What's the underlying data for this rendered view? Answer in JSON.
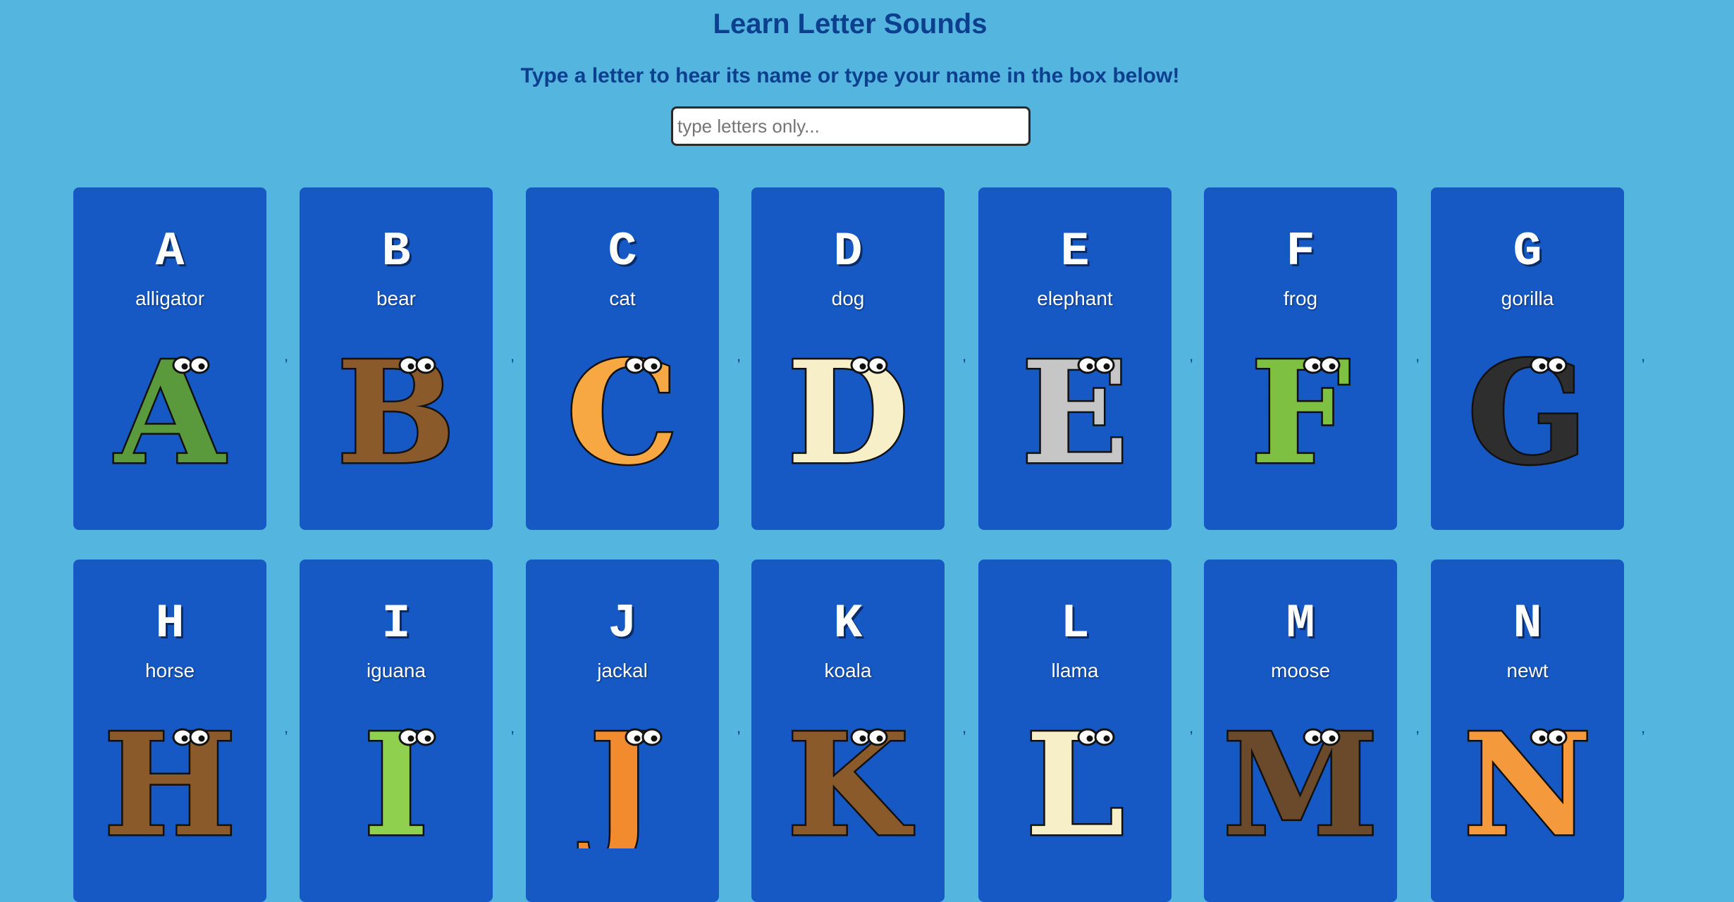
{
  "page": {
    "title": "Learn Letter Sounds",
    "instructions": "Type a letter to hear its name or type your name in the box below!",
    "input_placeholder": "type letters only...",
    "separator": ","
  },
  "cards": [
    {
      "letter": "A",
      "word": "alligator",
      "color": "#5a9a3c",
      "icon": "alligator-icon"
    },
    {
      "letter": "B",
      "word": "bear",
      "color": "#8a5a2b",
      "icon": "bear-icon"
    },
    {
      "letter": "C",
      "word": "cat",
      "color": "#f7a843",
      "icon": "cat-icon"
    },
    {
      "letter": "D",
      "word": "dog",
      "color": "#f7efc8",
      "icon": "dog-icon"
    },
    {
      "letter": "E",
      "word": "elephant",
      "color": "#c6c6c6",
      "icon": "elephant-icon"
    },
    {
      "letter": "F",
      "word": "frog",
      "color": "#7ec142",
      "icon": "frog-icon"
    },
    {
      "letter": "G",
      "word": "gorilla",
      "color": "#2e2e2e",
      "icon": "gorilla-icon"
    },
    {
      "letter": "H",
      "word": "horse",
      "color": "#8a5a2b",
      "icon": "horse-icon"
    },
    {
      "letter": "I",
      "word": "iguana",
      "color": "#8fd14f",
      "icon": "iguana-icon"
    },
    {
      "letter": "J",
      "word": "jackal",
      "color": "#f28a2e",
      "icon": "jackal-icon"
    },
    {
      "letter": "K",
      "word": "koala",
      "color": "#8a5a2b",
      "icon": "koala-icon"
    },
    {
      "letter": "L",
      "word": "llama",
      "color": "#f7efc8",
      "icon": "llama-icon"
    },
    {
      "letter": "M",
      "word": "moose",
      "color": "#6b4a2b",
      "icon": "moose-icon"
    },
    {
      "letter": "N",
      "word": "newt",
      "color": "#f59a3c",
      "icon": "newt-icon"
    }
  ]
}
